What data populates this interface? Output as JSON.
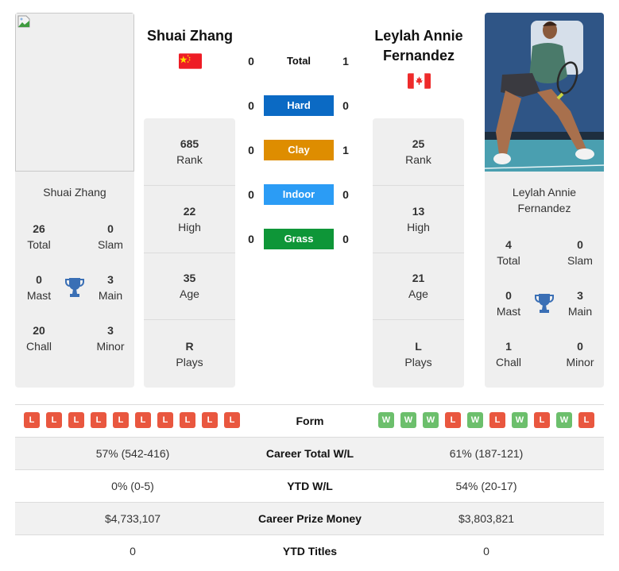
{
  "player1": {
    "name": "Shuai Zhang",
    "country": "China",
    "flag_icon": "china-flag-icon",
    "titles": {
      "total": {
        "value": "26",
        "label": "Total"
      },
      "slam": {
        "value": "0",
        "label": "Slam"
      },
      "masters": {
        "value": "0",
        "label": "Mast"
      },
      "main": {
        "value": "3",
        "label": "Main"
      },
      "challenger": {
        "value": "20",
        "label": "Chall"
      },
      "minor": {
        "value": "3",
        "label": "Minor"
      }
    },
    "stats": [
      {
        "value": "685",
        "label": "Rank"
      },
      {
        "value": "22",
        "label": "High"
      },
      {
        "value": "35",
        "label": "Age"
      },
      {
        "value": "R",
        "label": "Plays"
      }
    ],
    "form": [
      "L",
      "L",
      "L",
      "L",
      "L",
      "L",
      "L",
      "L",
      "L",
      "L"
    ]
  },
  "player2": {
    "name": "Leylah Annie Fernandez",
    "name_line1": "Leylah Annie",
    "name_line2": "Fernandez",
    "country": "Canada",
    "flag_icon": "canada-flag-icon",
    "titles": {
      "total": {
        "value": "4",
        "label": "Total"
      },
      "slam": {
        "value": "0",
        "label": "Slam"
      },
      "masters": {
        "value": "0",
        "label": "Mast"
      },
      "main": {
        "value": "3",
        "label": "Main"
      },
      "challenger": {
        "value": "1",
        "label": "Chall"
      },
      "minor": {
        "value": "0",
        "label": "Minor"
      }
    },
    "stats": [
      {
        "value": "25",
        "label": "Rank"
      },
      {
        "value": "13",
        "label": "High"
      },
      {
        "value": "21",
        "label": "Age"
      },
      {
        "value": "L",
        "label": "Plays"
      }
    ],
    "form": [
      "W",
      "W",
      "W",
      "L",
      "W",
      "L",
      "W",
      "L",
      "W",
      "L"
    ]
  },
  "h2h": [
    {
      "surface": "Total",
      "p1": "0",
      "p2": "1",
      "color": ""
    },
    {
      "surface": "Hard",
      "p1": "0",
      "p2": "0",
      "color": "#0b6ac4"
    },
    {
      "surface": "Clay",
      "p1": "0",
      "p2": "1",
      "color": "#de8d00"
    },
    {
      "surface": "Indoor",
      "p1": "0",
      "p2": "0",
      "color": "#2b9cf5"
    },
    {
      "surface": "Grass",
      "p1": "0",
      "p2": "0",
      "color": "#0e9638"
    }
  ],
  "comparison": {
    "form_label": "Form",
    "rows": [
      {
        "label": "Career Total W/L",
        "p1": "57% (542-416)",
        "p2": "61% (187-121)"
      },
      {
        "label": "YTD W/L",
        "p1": "0% (0-5)",
        "p2": "54% (20-17)"
      },
      {
        "label": "Career Prize Money",
        "p1": "$4,733,107",
        "p2": "$3,803,821"
      },
      {
        "label": "YTD Titles",
        "p1": "0",
        "p2": "0"
      }
    ]
  },
  "colors": {
    "loss": "#e9573f",
    "win": "#6cbf6c",
    "trophy": "#3a6fb5",
    "card_bg": "#efefef"
  }
}
